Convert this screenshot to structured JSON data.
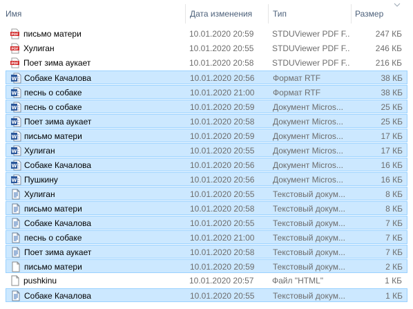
{
  "columns": {
    "name": "Имя",
    "date": "Дата изменения",
    "type": "Тип",
    "size": "Размер"
  },
  "files": [
    {
      "icon": "pdf-icon",
      "name": "письмо матери",
      "date": "10.01.2020 20:59",
      "type": "STDUViewer PDF F...",
      "size": "247 КБ",
      "selected": false
    },
    {
      "icon": "pdf-icon",
      "name": "Хулиган",
      "date": "10.01.2020 20:55",
      "type": "STDUViewer PDF F...",
      "size": "246 КБ",
      "selected": false
    },
    {
      "icon": "pdf-icon",
      "name": "Поет зима аукает",
      "date": "10.01.2020 20:58",
      "type": "STDUViewer PDF F...",
      "size": "216 КБ",
      "selected": false
    },
    {
      "icon": "word-icon",
      "name": "Собаке Качалова",
      "date": "10.01.2020 20:56",
      "type": "Формат RTF",
      "size": "38 КБ",
      "selected": true
    },
    {
      "icon": "word-icon",
      "name": "песнь о собаке",
      "date": "10.01.2020 21:00",
      "type": "Формат RTF",
      "size": "38 КБ",
      "selected": true
    },
    {
      "icon": "word-icon",
      "name": "песнь о собаке",
      "date": "10.01.2020 20:59",
      "type": "Документ Micros...",
      "size": "25 КБ",
      "selected": true
    },
    {
      "icon": "word-icon",
      "name": "Поет зима аукает",
      "date": "10.01.2020 20:58",
      "type": "Документ Micros...",
      "size": "25 КБ",
      "selected": true
    },
    {
      "icon": "word-icon",
      "name": "письмо матери",
      "date": "10.01.2020 20:59",
      "type": "Документ Micros...",
      "size": "17 КБ",
      "selected": true
    },
    {
      "icon": "word-icon",
      "name": "Хулиган",
      "date": "10.01.2020 20:55",
      "type": "Документ Micros...",
      "size": "17 КБ",
      "selected": true
    },
    {
      "icon": "word-icon",
      "name": "Собаке Качалова",
      "date": "10.01.2020 20:56",
      "type": "Документ Micros...",
      "size": "16 КБ",
      "selected": true
    },
    {
      "icon": "word-icon",
      "name": "Пушкину",
      "date": "10.01.2020 20:56",
      "type": "Документ Micros...",
      "size": "16 КБ",
      "selected": true
    },
    {
      "icon": "text-icon",
      "name": "Хулиган",
      "date": "10.01.2020 20:55",
      "type": "Текстовый докум...",
      "size": "8 КБ",
      "selected": true
    },
    {
      "icon": "text-icon",
      "name": "письмо матери",
      "date": "10.01.2020 20:58",
      "type": "Текстовый докум...",
      "size": "8 КБ",
      "selected": true
    },
    {
      "icon": "text-icon",
      "name": "Собаке Качалова",
      "date": "10.01.2020 20:55",
      "type": "Текстовый докум...",
      "size": "7 КБ",
      "selected": true
    },
    {
      "icon": "text-icon",
      "name": "песнь о собаке",
      "date": "10.01.2020 21:00",
      "type": "Текстовый докум...",
      "size": "7 КБ",
      "selected": true
    },
    {
      "icon": "text-icon",
      "name": "Поет зима аукает",
      "date": "10.01.2020 20:58",
      "type": "Текстовый докум...",
      "size": "7 КБ",
      "selected": true
    },
    {
      "icon": "blank-file-icon",
      "name": "письмо матери",
      "date": "10.01.2020 20:59",
      "type": "Текстовый докум...",
      "size": "2 КБ",
      "selected": true
    },
    {
      "icon": "blank-file-icon",
      "name": "pushkinu",
      "date": "10.01.2020 20:57",
      "type": "Файл \"HTML\"",
      "size": "1 КБ",
      "selected": false
    },
    {
      "icon": "text-icon",
      "name": "Собаке Качалова",
      "date": "10.01.2020 20:55",
      "type": "Текстовый докум...",
      "size": "1 КБ",
      "selected": true
    }
  ]
}
